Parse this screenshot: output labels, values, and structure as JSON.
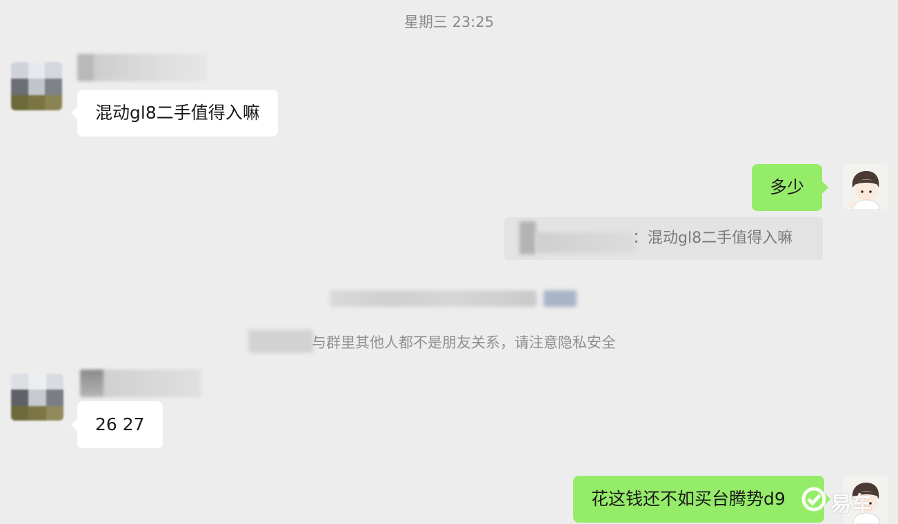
{
  "timestamp": "星期三 23:25",
  "messages": {
    "m1": {
      "text": "混动gl8二手值得入嘛"
    },
    "m2": {
      "text": "多少"
    },
    "m2_quote": {
      "text": "：混动gl8二手值得入嘛"
    },
    "system_notice": {
      "text": "与群里其他人都不是朋友关系，请注意隐私安全"
    },
    "m3": {
      "text": "26 27"
    },
    "m4": {
      "text": "花这钱还不如买台腾势d9"
    }
  },
  "watermark": {
    "text": "易车"
  },
  "colors": {
    "background": "#ededee",
    "bubble_incoming": "#ffffff",
    "bubble_outgoing": "#95ec69",
    "quote_background": "#e3e3e4"
  }
}
